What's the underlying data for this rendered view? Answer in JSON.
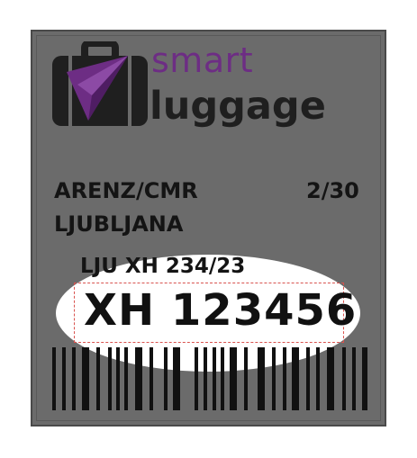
{
  "brand": {
    "name_top": "smart",
    "name_bottom": "luggage",
    "logo_icon": "suitcase-with-paper-plane-icon",
    "accent_color": "#6d2d84",
    "dark_color": "#1f1f1f"
  },
  "tag": {
    "passenger": "ARENZ/CMR",
    "bag_count": "2/30",
    "destination": "LJUBLJANA",
    "flight_info": "LJU XH 234/23",
    "tag_number": "XH 123456",
    "background_color": "#6b6b6b",
    "highlight_color": "#ffffff",
    "dashed_box_color": "#d9534f"
  },
  "barcode": {
    "icon": "barcode-icon"
  }
}
